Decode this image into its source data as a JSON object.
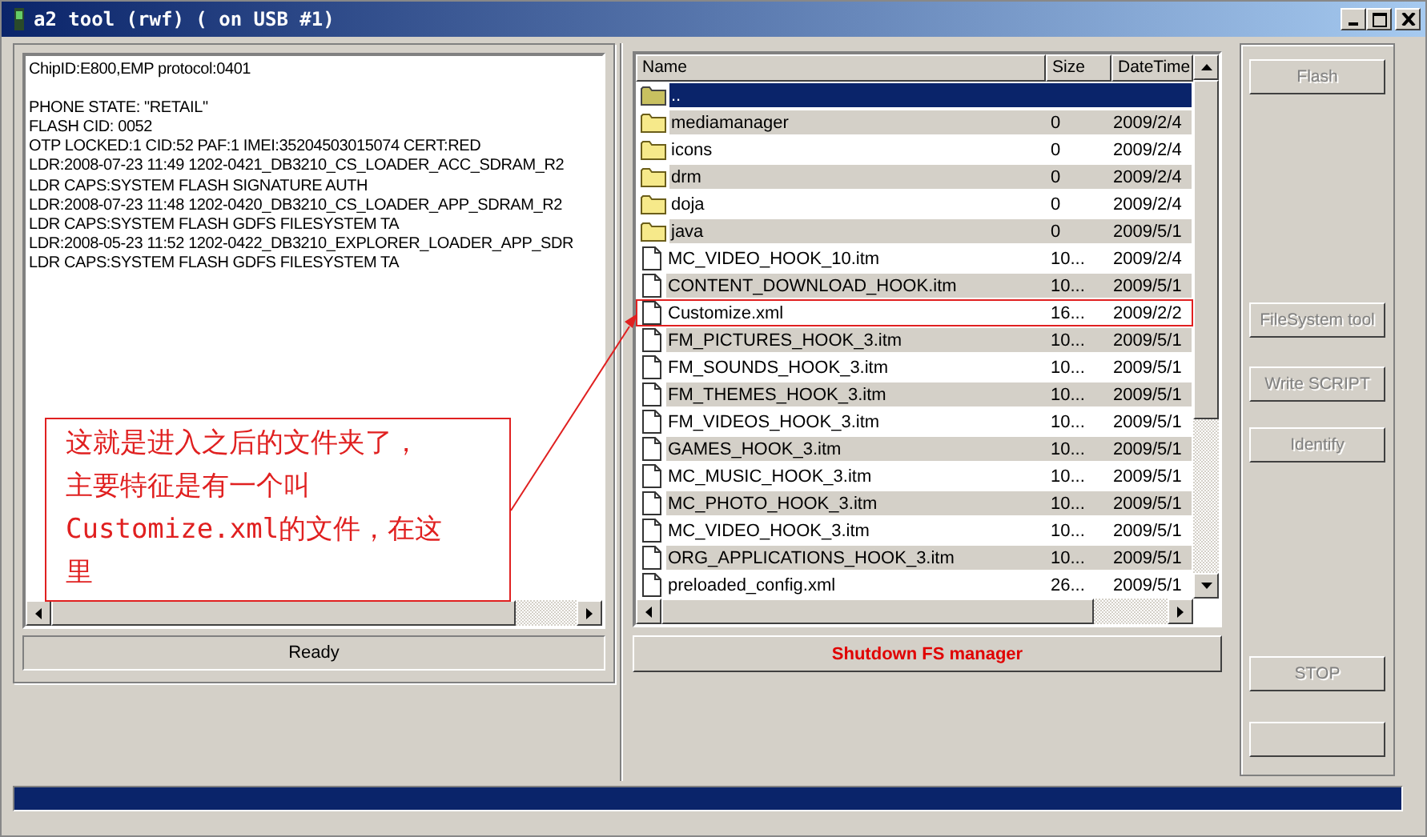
{
  "window": {
    "title": "a2 tool (rwf) ( on USB #1)"
  },
  "log": [
    [
      "ChipID:E800,EMP protocol:0401"
    ],
    [
      "PHONE STATE: \"RETAIL\"",
      "FLASH CID: 0052",
      "OTP LOCKED:1 CID:52 PAF:1 IMEI:35204503015074 CERT:RED",
      "LDR:2008-07-23 11:49 1202-0421_DB3210_CS_LOADER_ACC_SDRAM_R2",
      "LDR CAPS:SYSTEM FLASH SIGNATURE AUTH",
      "LDR:2008-07-23 11:48 1202-0420_DB3210_CS_LOADER_APP_SDRAM_R2",
      "LDR CAPS:SYSTEM FLASH GDFS FILESYSTEM TA",
      "LDR:2008-05-23 11:52 1202-0422_DB3210_EXPLORER_LOADER_APP_SDR",
      "LDR CAPS:SYSTEM FLASH GDFS FILESYSTEM TA"
    ]
  ],
  "status": "Ready",
  "file_list": {
    "columns": [
      "Name",
      "Size",
      "DateTime"
    ],
    "rows": [
      {
        "kind": "parent",
        "name": "..",
        "size": "",
        "date": "",
        "selected": true,
        "highlighted": false
      },
      {
        "kind": "folder",
        "name": "mediamanager",
        "size": "0",
        "date": "2009/2/4",
        "selected": false,
        "highlighted": false
      },
      {
        "kind": "folder",
        "name": "icons",
        "size": "0",
        "date": "2009/2/4",
        "selected": false,
        "highlighted": false
      },
      {
        "kind": "folder",
        "name": "drm",
        "size": "0",
        "date": "2009/2/4",
        "selected": false,
        "highlighted": false
      },
      {
        "kind": "folder",
        "name": "doja",
        "size": "0",
        "date": "2009/2/4",
        "selected": false,
        "highlighted": false
      },
      {
        "kind": "folder",
        "name": "java",
        "size": "0",
        "date": "2009/5/1",
        "selected": false,
        "highlighted": false
      },
      {
        "kind": "file",
        "name": "MC_VIDEO_HOOK_10.itm",
        "size": "10...",
        "date": "2009/2/4",
        "selected": false,
        "highlighted": false
      },
      {
        "kind": "file",
        "name": "CONTENT_DOWNLOAD_HOOK.itm",
        "size": "10...",
        "date": "2009/5/1",
        "selected": false,
        "highlighted": false
      },
      {
        "kind": "file",
        "name": "Customize.xml",
        "size": "16...",
        "date": "2009/2/2",
        "selected": false,
        "highlighted": true
      },
      {
        "kind": "file",
        "name": "FM_PICTURES_HOOK_3.itm",
        "size": "10...",
        "date": "2009/5/1",
        "selected": false,
        "highlighted": false
      },
      {
        "kind": "file",
        "name": "FM_SOUNDS_HOOK_3.itm",
        "size": "10...",
        "date": "2009/5/1",
        "selected": false,
        "highlighted": false
      },
      {
        "kind": "file",
        "name": "FM_THEMES_HOOK_3.itm",
        "size": "10...",
        "date": "2009/5/1",
        "selected": false,
        "highlighted": false
      },
      {
        "kind": "file",
        "name": "FM_VIDEOS_HOOK_3.itm",
        "size": "10...",
        "date": "2009/5/1",
        "selected": false,
        "highlighted": false
      },
      {
        "kind": "file",
        "name": "GAMES_HOOK_3.itm",
        "size": "10...",
        "date": "2009/5/1",
        "selected": false,
        "highlighted": false
      },
      {
        "kind": "file",
        "name": "MC_MUSIC_HOOK_3.itm",
        "size": "10...",
        "date": "2009/5/1",
        "selected": false,
        "highlighted": false
      },
      {
        "kind": "file",
        "name": "MC_PHOTO_HOOK_3.itm",
        "size": "10...",
        "date": "2009/5/1",
        "selected": false,
        "highlighted": false
      },
      {
        "kind": "file",
        "name": "MC_VIDEO_HOOK_3.itm",
        "size": "10...",
        "date": "2009/5/1",
        "selected": false,
        "highlighted": false
      },
      {
        "kind": "file",
        "name": "ORG_APPLICATIONS_HOOK_3.itm",
        "size": "10...",
        "date": "2009/5/1",
        "selected": false,
        "highlighted": false
      },
      {
        "kind": "file",
        "name": "preloaded_config.xml",
        "size": "26...",
        "date": "2009/5/1",
        "selected": false,
        "highlighted": false
      }
    ]
  },
  "shutdown_button": "Shutdown FS manager",
  "side_buttons": [
    {
      "label": "Flash",
      "disabled": true
    },
    {
      "label": "FileSystem tool",
      "disabled": true
    },
    {
      "label": "Write SCRIPT",
      "disabled": true
    },
    {
      "label": "Identify",
      "disabled": true
    },
    {
      "label": "STOP",
      "disabled": true
    }
  ],
  "progress": {
    "level": 1
  },
  "annotation": {
    "lines": [
      "这就是进入之后的文件夹了，",
      "主要特征是有一个叫",
      "Customize.xml的文件，在这",
      "里"
    ]
  }
}
